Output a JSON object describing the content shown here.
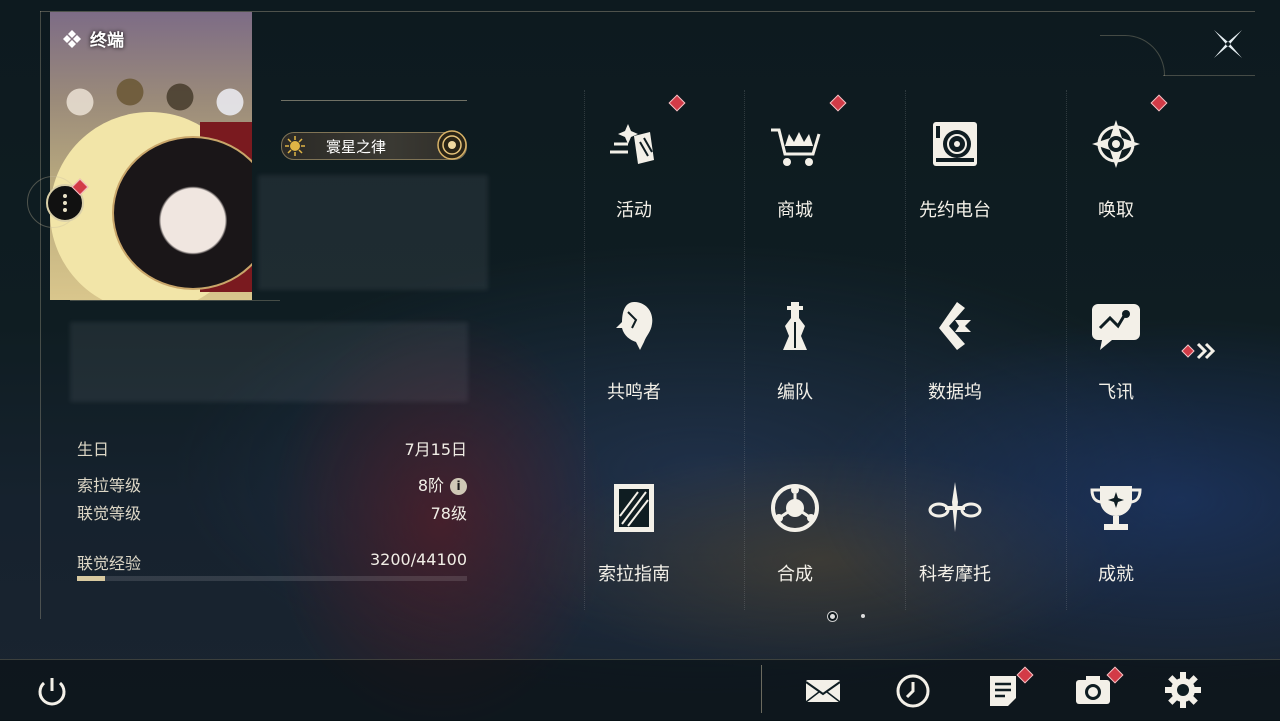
{
  "header": {
    "terminal_label": "终端",
    "close_icon": "close-icon"
  },
  "profile": {
    "title_badge": "寰星之律",
    "avatar_icon": "avatar",
    "more_icon": "more-vertical-icon"
  },
  "stats": [
    {
      "key": "生日",
      "value": "7月15日"
    },
    {
      "key": "索拉等级",
      "value": "8阶"
    },
    {
      "key": "联觉等级",
      "value": "78级"
    },
    {
      "key": "联觉经验",
      "value": "3200/44100"
    }
  ],
  "xp_progress": 0.0726,
  "menu": [
    {
      "label": "活动",
      "icon": "activity-icon",
      "badge": true
    },
    {
      "label": "商城",
      "icon": "shop-icon",
      "badge": true
    },
    {
      "label": "先约电台",
      "icon": "radio-icon",
      "badge": false
    },
    {
      "label": "唤取",
      "icon": "convene-icon",
      "badge": true
    },
    {
      "label": "共鸣者",
      "icon": "resonator-icon",
      "badge": false
    },
    {
      "label": "编队",
      "icon": "team-icon",
      "badge": false
    },
    {
      "label": "数据坞",
      "icon": "databank-icon",
      "badge": false
    },
    {
      "label": "飞讯",
      "icon": "message-icon",
      "badge": false
    },
    {
      "label": "索拉指南",
      "icon": "guidebook-icon",
      "badge": false
    },
    {
      "label": "合成",
      "icon": "synthesis-icon",
      "badge": false
    },
    {
      "label": "科考摩托",
      "icon": "motorbike-icon",
      "badge": false
    },
    {
      "label": "成就",
      "icon": "trophy-icon",
      "badge": false
    }
  ],
  "pager": {
    "pages": 2,
    "current": 1
  },
  "toolbar": [
    {
      "name": "mail-icon",
      "badge": false
    },
    {
      "name": "clock-icon",
      "badge": false
    },
    {
      "name": "notice-icon",
      "badge": true
    },
    {
      "name": "camera-icon",
      "badge": true
    },
    {
      "name": "settings-icon",
      "badge": false
    }
  ],
  "colors": {
    "accent": "#d8c9a0",
    "badge": "#d23b47",
    "text": "#f3f0e8"
  }
}
